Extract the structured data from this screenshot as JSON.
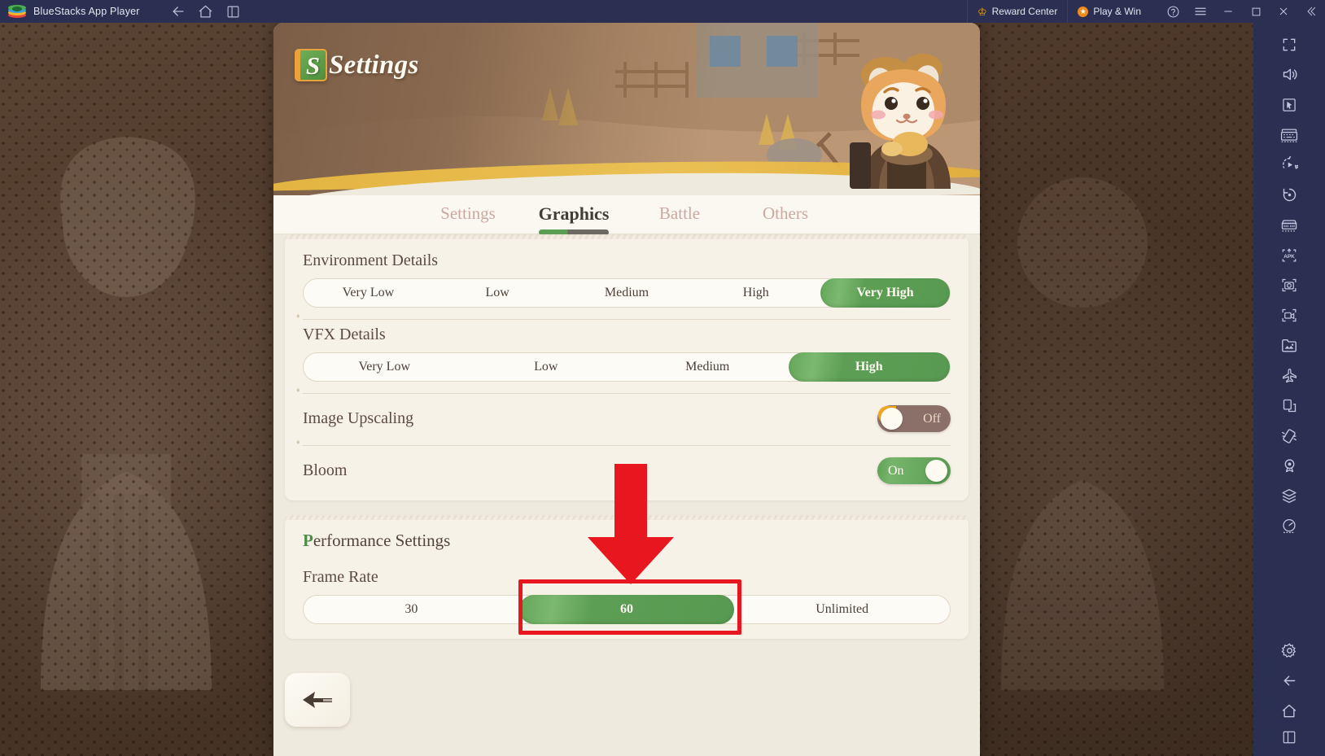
{
  "titlebar": {
    "app_name": "BlueStacks App Player",
    "logo_icon": "bluestacks-logo",
    "nav": [
      {
        "name": "back-arrow-icon",
        "label": "Back"
      },
      {
        "name": "home-icon",
        "label": "Home"
      },
      {
        "name": "multi-instance-icon",
        "label": "Instances"
      }
    ],
    "reward_center": "Reward Center",
    "reward_icon": "crown-icon",
    "play_and_win": "Play & Win",
    "play_icon": "coin-icon",
    "help_icon": "help-circle-icon",
    "menu_icon": "hamburger-menu-icon",
    "minimize_icon": "minimize-icon",
    "maximize_icon": "maximize-icon",
    "close_icon": "close-icon",
    "collapse_icon": "double-chevron-left-icon"
  },
  "game": {
    "header_title": "Settings",
    "header_icon": "green-book-icon",
    "mascot": "hamster-character",
    "tabs": [
      {
        "label": "Settings",
        "active": false
      },
      {
        "label": "Graphics",
        "active": true
      },
      {
        "label": "Battle",
        "active": false
      },
      {
        "label": "Others",
        "active": false
      }
    ],
    "graphics": {
      "environment_details": {
        "label": "Environment Details",
        "options": [
          "Very Low",
          "Low",
          "Medium",
          "High",
          "Very High"
        ],
        "selected": "Very High"
      },
      "vfx_details": {
        "label": "VFX Details",
        "options": [
          "Very Low",
          "Low",
          "Medium",
          "High"
        ],
        "selected": "High"
      },
      "image_upscaling": {
        "label": "Image Upscaling",
        "state": "Off",
        "on": false
      },
      "bloom": {
        "label": "Bloom",
        "state": "On",
        "on": true
      }
    },
    "performance": {
      "title": "Performance Settings",
      "frame_rate": {
        "label": "Frame Rate",
        "options": [
          "30",
          "60",
          "Unlimited"
        ],
        "selected": "60"
      }
    },
    "back_button_icon": "back-arrow-icon"
  },
  "annotations": {
    "highlight_color": "#e8171f",
    "highlight_target": "60",
    "arrow_icon": "down-arrow-annotation"
  },
  "colors": {
    "accent_green": "#5d9e55",
    "panel_bg": "#efeade",
    "card_bg": "#f7f2e8",
    "titlebar_bg": "#2b2f52",
    "toggle_off": "#8a7068",
    "toggle_off_accent": "#f0a41f",
    "annotation_red": "#e8171f"
  },
  "sidebar": {
    "items": [
      {
        "name": "fullscreen-icon"
      },
      {
        "name": "volume-icon"
      },
      {
        "name": "cursor-pointer-icon"
      },
      {
        "name": "keyboard-controls-icon"
      },
      {
        "name": "macro-play-icon"
      },
      {
        "name": "rotate-icon"
      },
      {
        "name": "gamepad-icon"
      },
      {
        "name": "install-apk-icon"
      },
      {
        "name": "screenshot-icon"
      },
      {
        "name": "screen-record-icon"
      },
      {
        "name": "media-manager-icon"
      },
      {
        "name": "eco-mode-icon"
      },
      {
        "name": "multi-instance-icon"
      },
      {
        "name": "shake-icon"
      },
      {
        "name": "location-icon"
      },
      {
        "name": "layers-icon"
      },
      {
        "name": "performance-meter-icon"
      }
    ],
    "bottom_items": [
      {
        "name": "gear-settings-icon"
      },
      {
        "name": "android-back-icon"
      },
      {
        "name": "android-home-icon"
      },
      {
        "name": "android-recents-icon"
      }
    ]
  }
}
